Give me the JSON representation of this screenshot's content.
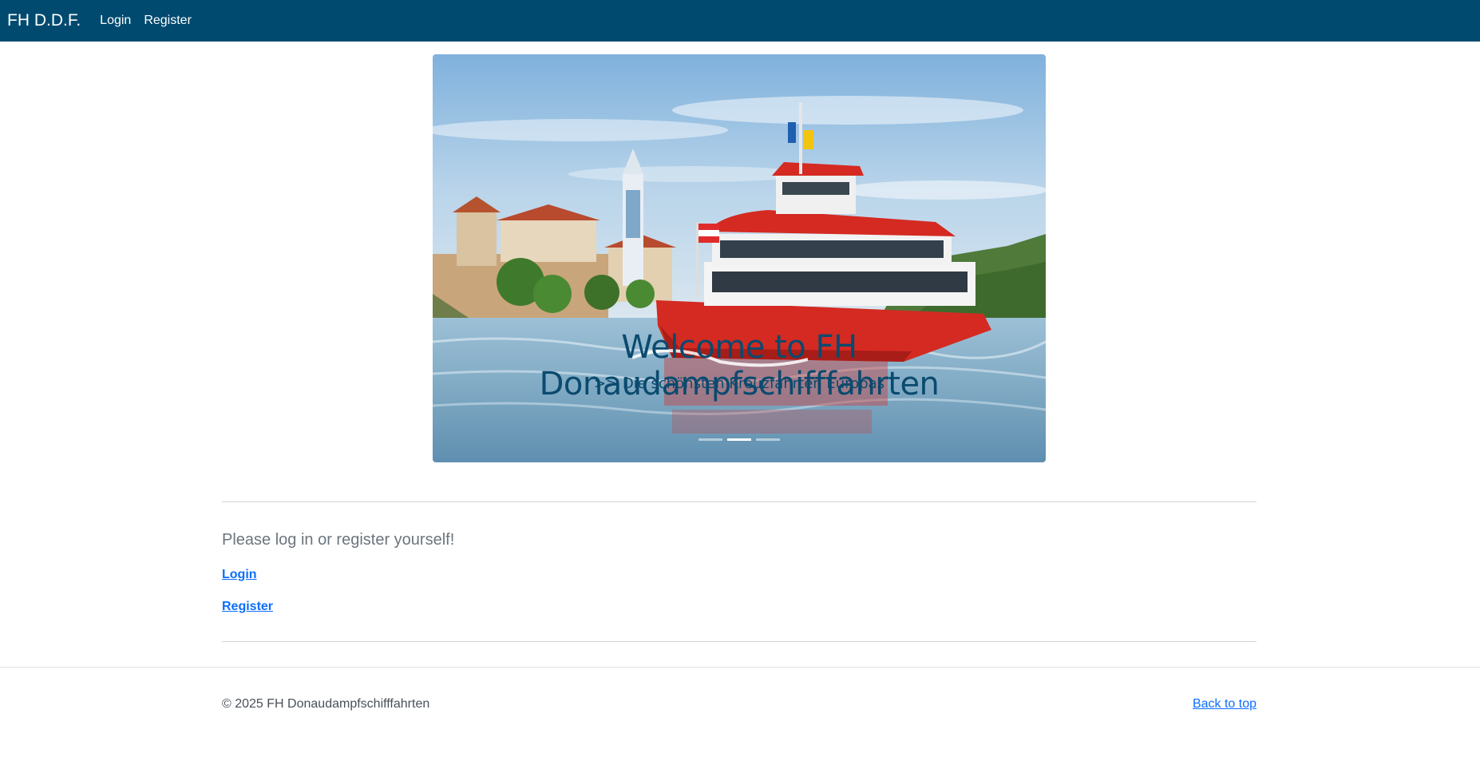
{
  "navbar": {
    "brand": "FH D.D.F.",
    "links": [
      {
        "label": "Login"
      },
      {
        "label": "Register"
      }
    ],
    "color": "#004a6f"
  },
  "hero": {
    "title": "Welcome to FH Donaudampfschifffahrten",
    "subtitle": ">> Die schönsten Kreuzfahrten Europas",
    "active_slide": 2,
    "slide_count": 3,
    "image": "river-cruise-ship-photo"
  },
  "main": {
    "prompt": "Please log in or register yourself!",
    "login_label": "Login",
    "register_label": "Register"
  },
  "footer": {
    "copyright": "© 2025 FH Donaudampfschifffahrten",
    "back_to_top": "Back to top"
  },
  "colors": {
    "link": "#0d6efd",
    "caption": "#0a4a6e"
  }
}
